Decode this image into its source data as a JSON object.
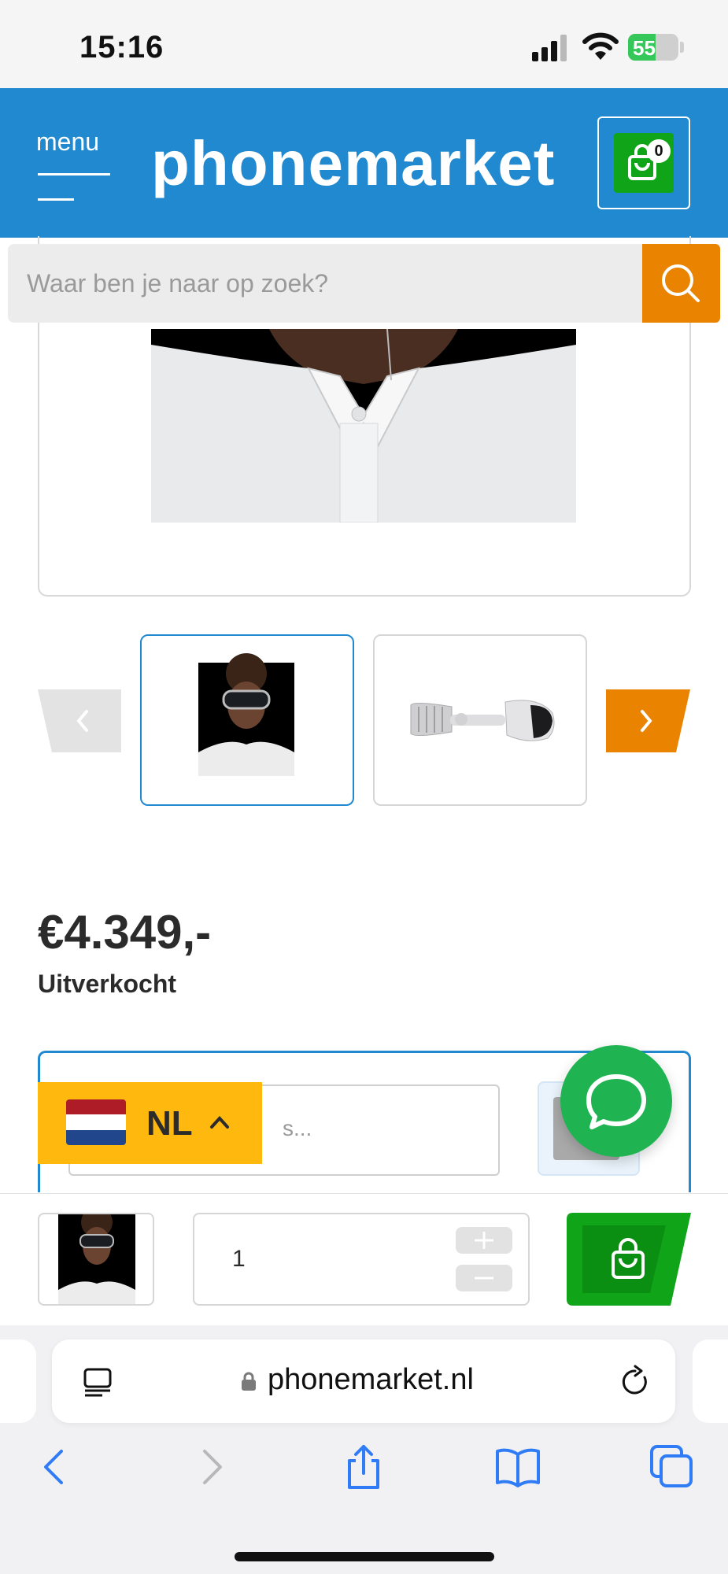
{
  "status_bar": {
    "time": "15:16",
    "battery": "55",
    "battery_level": 0.55,
    "icons": [
      "signal-icon",
      "wifi-icon",
      "battery-icon"
    ]
  },
  "header": {
    "menu_label": "menu",
    "brand": "phonemarket",
    "cart_count": "0",
    "colors": {
      "header_bg": "#2189cf",
      "cart_bg": "#10a518"
    }
  },
  "search": {
    "placeholder": "Waar ben je naar op zoek?",
    "button_color": "#ea8300"
  },
  "product": {
    "price": "€4.349,-",
    "stock_status": "Uitverkocht",
    "images": [
      {
        "icon": "vision-pro-person-image"
      },
      {
        "icon": "vision-pro-headset-image"
      }
    ]
  },
  "form": {
    "input_fragment": "s..."
  },
  "language": {
    "code": "NL",
    "flag_colors": [
      "#ae1c28",
      "#ffffff",
      "#21468b"
    ]
  },
  "sticky_bar": {
    "quantity": "1",
    "colors": {
      "add_to_cart": "#10a518"
    }
  },
  "browser": {
    "url": "phonemarket.nl",
    "toolbar": [
      "back-icon",
      "forward-icon",
      "share-icon",
      "bookmarks-icon",
      "tabs-icon"
    ]
  }
}
